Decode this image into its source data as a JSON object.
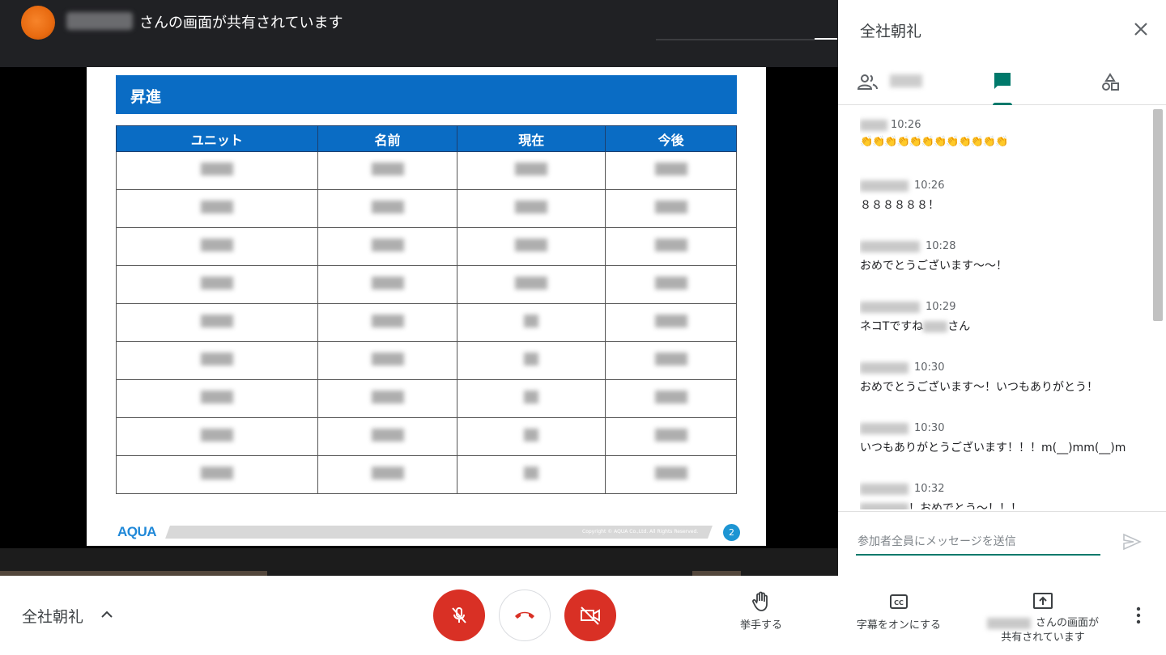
{
  "topbar": {
    "presenting_text": "さんの画面が共有されています"
  },
  "slide": {
    "title": "昇進",
    "table": {
      "headers": [
        "ユニット",
        "名前",
        "現在",
        "今後"
      ]
    },
    "logo": "AQUA",
    "copyright": "Copyright © AQUA Co.,Ltd. All Rights Reserved.",
    "page_number": "2"
  },
  "panel": {
    "title": "全社朝礼",
    "messages": [
      {
        "time": "10:26",
        "text": "👏👏👏👏👏👏👏👏👏👏👏👏"
      },
      {
        "time": "10:26",
        "text": "８８８８８８！"
      },
      {
        "time": "10:28",
        "text": "おめでとうございます〜〜！"
      },
      {
        "time": "10:29",
        "text_prefix": "ネコTですね",
        "text_suffix": "さん"
      },
      {
        "time": "10:30",
        "text": "おめでとうございます〜！いつもありがとう！"
      },
      {
        "time": "10:30",
        "text": "いつもありがとうございます！！！m(__)mm(__)m"
      },
      {
        "time": "10:32",
        "text": "！おめでとう〜！！！"
      }
    ],
    "input_placeholder": "参加者全員にメッセージを送信"
  },
  "bottombar": {
    "meeting_name": "全社朝礼",
    "raise_hand_label": "挙手する",
    "captions_label": "字幕をオンにする",
    "present_label_line1": "さんの画面が",
    "present_label_line2": "共有されています"
  },
  "colors": {
    "accent": "#00796b",
    "danger": "#d93025",
    "slide_blue": "#0a6cc4"
  }
}
